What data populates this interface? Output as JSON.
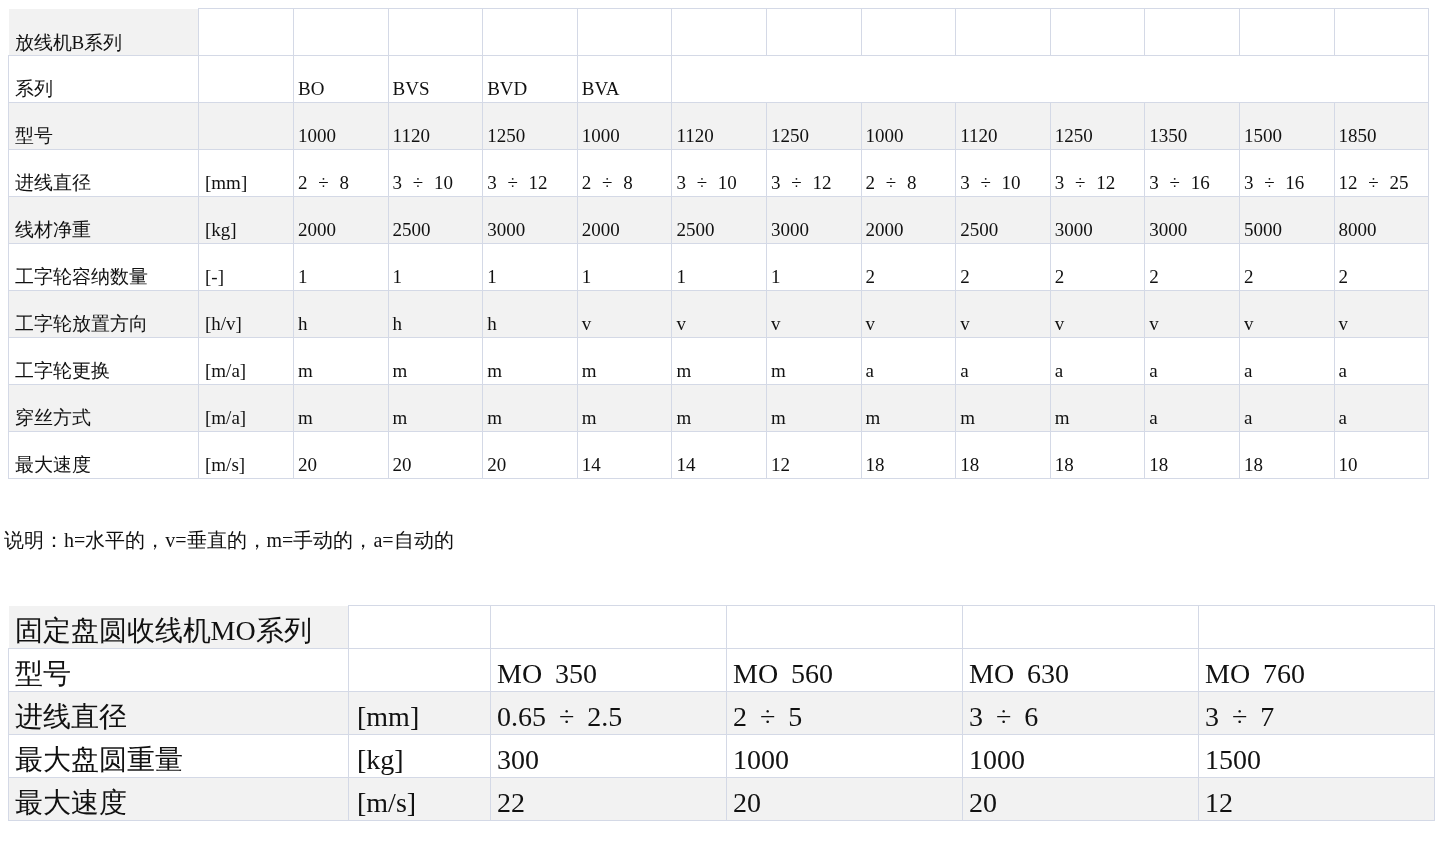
{
  "table_b": {
    "title": "放线机B系列",
    "series_row": {
      "label": "系列",
      "series": [
        "BO",
        "BVS",
        "BVD",
        "BVA"
      ]
    },
    "rows": [
      {
        "label": "型号",
        "unit": "",
        "values": [
          "1000",
          "1120",
          "1250",
          "1000",
          "1120",
          "1250",
          "1000",
          "1120",
          "1250",
          "1350",
          "1500",
          "1850"
        ]
      },
      {
        "label": "进线直径",
        "unit": "[mm]",
        "values": [
          "2 ÷ 8",
          "3 ÷ 10",
          "3 ÷ 12",
          "2 ÷ 8",
          "3 ÷ 10",
          "3 ÷ 12",
          "2 ÷ 8",
          "3 ÷ 10",
          "3 ÷ 12",
          "3 ÷ 16",
          "3 ÷ 16",
          "12 ÷ 25"
        ]
      },
      {
        "label": "线材净重",
        "unit": "[kg]",
        "values": [
          "2000",
          "2500",
          "3000",
          "2000",
          "2500",
          "3000",
          "2000",
          "2500",
          "3000",
          "3000",
          "5000",
          "8000"
        ]
      },
      {
        "label": "工字轮容纳数量",
        "unit": "[-]",
        "values": [
          "1",
          "1",
          "1",
          "1",
          "1",
          "1",
          "2",
          "2",
          "2",
          "2",
          "2",
          "2"
        ]
      },
      {
        "label": "工字轮放置方向",
        "unit": "[h/v]",
        "values": [
          "h",
          "h",
          "h",
          "v",
          "v",
          "v",
          "v",
          "v",
          "v",
          "v",
          "v",
          "v"
        ]
      },
      {
        "label": "工字轮更换",
        "unit": "[m/a]",
        "values": [
          "m",
          "m",
          "m",
          "m",
          "m",
          "m",
          "a",
          "a",
          "a",
          "a",
          "a",
          "a"
        ]
      },
      {
        "label": "穿丝方式",
        "unit": "[m/a]",
        "values": [
          "m",
          "m",
          "m",
          "m",
          "m",
          "m",
          "m",
          "m",
          "m",
          "a",
          "a",
          "a"
        ]
      },
      {
        "label": "最大速度",
        "unit": "[m/s]",
        "values": [
          "20",
          "20",
          "20",
          "14",
          "14",
          "12",
          "18",
          "18",
          "18",
          "18",
          "18",
          "10"
        ]
      }
    ]
  },
  "note": "说明：h=水平的，v=垂直的，m=手动的，a=自动的",
  "table_mo": {
    "title": "固定盘圆收线机MO系列",
    "rows": [
      {
        "label": "型号",
        "unit": "",
        "values": [
          "MO 350",
          "MO 560",
          "MO 630",
          "MO 760"
        ]
      },
      {
        "label": "进线直径",
        "unit": "[mm]",
        "values": [
          "0.65 ÷ 2.5",
          "2 ÷ 5",
          "3 ÷ 6",
          "3 ÷ 7"
        ]
      },
      {
        "label": "最大盘圆重量",
        "unit": "[kg]",
        "values": [
          "300",
          "1000",
          "1000",
          "1500"
        ]
      },
      {
        "label": "最大速度",
        "unit": "[m/s]",
        "values": [
          "22",
          "20",
          "20",
          "12"
        ]
      }
    ]
  }
}
